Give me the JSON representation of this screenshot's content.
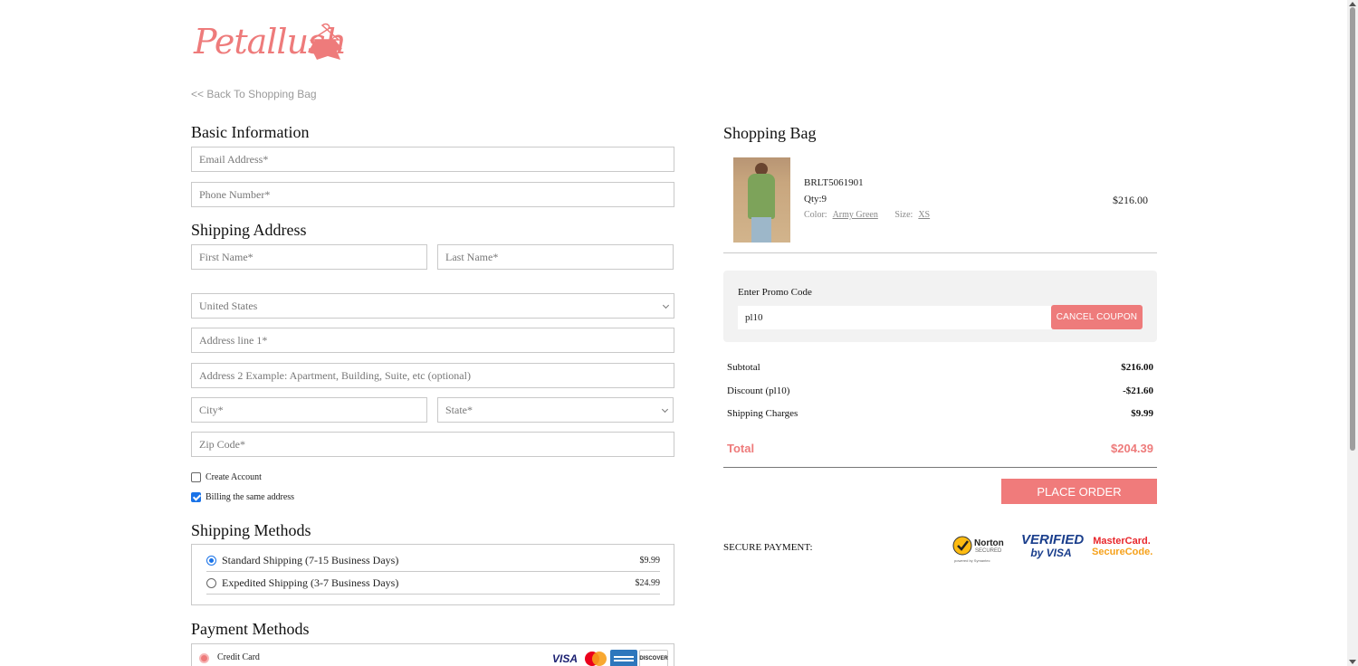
{
  "brand": {
    "logo_text": "Petallush"
  },
  "nav": {
    "back_link": "<< Back To Shopping Bag"
  },
  "basic_info": {
    "title": "Basic Information",
    "email_placeholder": "Email Address*",
    "phone_placeholder": "Phone Number*"
  },
  "shipping_address": {
    "title": "Shipping Address",
    "first_name_placeholder": "First Name*",
    "last_name_placeholder": "Last Name*",
    "country_value": "United States",
    "address1_placeholder": "Address line 1*",
    "address2_placeholder": "Address 2 Example: Apartment, Building, Suite, etc (optional)",
    "city_placeholder": "City*",
    "state_value": "State*",
    "zip_placeholder": "Zip Code*",
    "create_account_label": "Create Account",
    "create_account_checked": false,
    "billing_same_label": "Billing the same address",
    "billing_same_checked": true
  },
  "shipping_methods": {
    "title": "Shipping Methods",
    "options": [
      {
        "label": "Standard Shipping (7-15 Business Days)",
        "price": "$9.99",
        "selected": true
      },
      {
        "label": "Expedited Shipping (3-7 Business Days)",
        "price": "$24.99",
        "selected": false
      }
    ]
  },
  "payment_methods": {
    "title": "Payment Methods",
    "option_label": "Credit Card",
    "cards": [
      "VISA",
      "mastercard-icon",
      "american-express-icon",
      "DISCOVER"
    ]
  },
  "bag": {
    "title": "Shopping Bag",
    "item": {
      "sku": "BRLT5061901",
      "qty_label": "Qty:9",
      "color_label": "Color:",
      "color_value": "Army Green",
      "size_label": "Size:",
      "size_value": "XS",
      "price": "$216.00"
    }
  },
  "promo": {
    "label": "Enter Promo Code",
    "value": "pl10",
    "button": "CANCEL COUPON"
  },
  "summary": {
    "subtotal_label": "Subtotal",
    "subtotal_value": "$216.00",
    "discount_label": "Discount (pl10)",
    "discount_value": "-$21.60",
    "shipping_label": "Shipping Charges",
    "shipping_value": "$9.99",
    "total_label": "Total",
    "total_value": "$204.39"
  },
  "actions": {
    "place_order": "PLACE ORDER"
  },
  "secure": {
    "label": "SECURE PAYMENT:",
    "norton_text": "Norton",
    "norton_sub": "SECURED",
    "norton_powered": "powered by Symantec",
    "verified_line1": "VERIFIED",
    "verified_line2": "by VISA",
    "mc_line1": "MasterCard.",
    "mc_line2": "SecureCode."
  },
  "colors": {
    "accent": "#ee7b7b",
    "check_blue": "#1a73e8"
  }
}
